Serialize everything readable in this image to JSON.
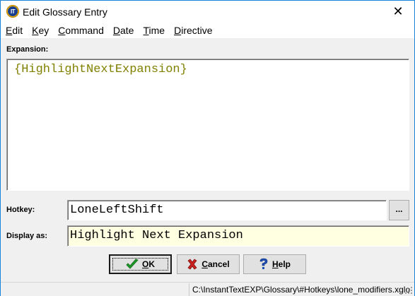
{
  "window": {
    "title": "Edit Glossary Entry",
    "app_icon_text": "IT",
    "close_glyph": "✕"
  },
  "menu": [
    {
      "acc": "E",
      "rest": "dit"
    },
    {
      "acc": "K",
      "rest": "ey"
    },
    {
      "acc": "C",
      "rest": "ommand"
    },
    {
      "acc": "D",
      "rest": "ate"
    },
    {
      "acc": "T",
      "rest": "ime"
    },
    {
      "acc": "D",
      "rest": "irective"
    }
  ],
  "expansion": {
    "label": "Expansion:",
    "value": "{HighlightNextExpansion}"
  },
  "hotkey": {
    "label": "Hotkey:",
    "value": "LoneLeftShift",
    "browse_label": "..."
  },
  "display_as": {
    "label": "Display as:",
    "value": "Highlight Next Expansion"
  },
  "buttons": {
    "ok": {
      "acc": "O",
      "rest": "K",
      "icon": "checkmark-icon"
    },
    "cancel": {
      "acc": "C",
      "rest": "ancel",
      "icon": "x-icon"
    },
    "help": {
      "acc": "H",
      "rest": "elp",
      "icon": "question-icon"
    }
  },
  "status": {
    "path": "C:\\InstantTextEXP\\Glossary\\#Hotkeys\\lone_modifiers.xglo"
  },
  "colors": {
    "expansion_text": "#808000",
    "display_field_bg": "#ffffe1",
    "window_border": "#1883d7"
  }
}
